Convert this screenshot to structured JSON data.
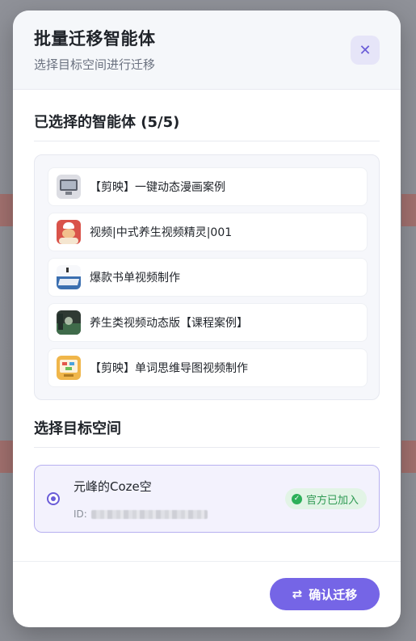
{
  "modal": {
    "title": "批量迁移智能体",
    "subtitle": "选择目标空间进行迁移",
    "close_icon": "close-icon"
  },
  "selected_section": {
    "title": "已选择的智能体 (5/5)",
    "agents": [
      {
        "name": "【剪映】一键动态漫画案例",
        "icon": "monitor-thumbnail"
      },
      {
        "name": "视频|中式养生视频精灵|001",
        "icon": "chef-thumbnail"
      },
      {
        "name": "爆款书单视频制作",
        "icon": "book-thumbnail"
      },
      {
        "name": "养生类视频动态版【课程案例】",
        "icon": "landscape-thumbnail"
      },
      {
        "name": "【剪映】单词思维导图视频制作",
        "icon": "mindmap-thumbnail"
      }
    ]
  },
  "target_section": {
    "title": "选择目标空间",
    "space": {
      "name": "元峰的Coze空",
      "id_label": "ID:",
      "badge": "官方已加入",
      "selected": true
    }
  },
  "footer": {
    "confirm_label": "确认迁移",
    "confirm_icon": "swap-icon"
  },
  "colors": {
    "accent": "#7565e6",
    "success": "#2db05a"
  }
}
